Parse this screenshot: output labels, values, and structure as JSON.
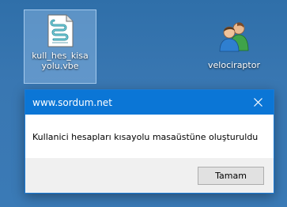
{
  "desktop": {
    "icons": [
      {
        "name": "kull_hes_kisayolu.vbe",
        "label": "kull_hes_kisa yolu.vbe",
        "icon": "vbscript-file-icon",
        "selected": true
      },
      {
        "name": "velociraptor",
        "label": "velociraptor",
        "icon": "users-icon",
        "selected": false
      }
    ]
  },
  "dialog": {
    "title": "www.sordum.net",
    "close_glyph": "✕",
    "message": "Kullanici hesapları kısayolu masaüstüne oluşturuldu",
    "ok_label": "Tamam"
  },
  "colors": {
    "desktop": "#3977b2",
    "titlebar": "#0b76d6",
    "footer": "#f0f0f0",
    "button": "#e1e1e1"
  }
}
